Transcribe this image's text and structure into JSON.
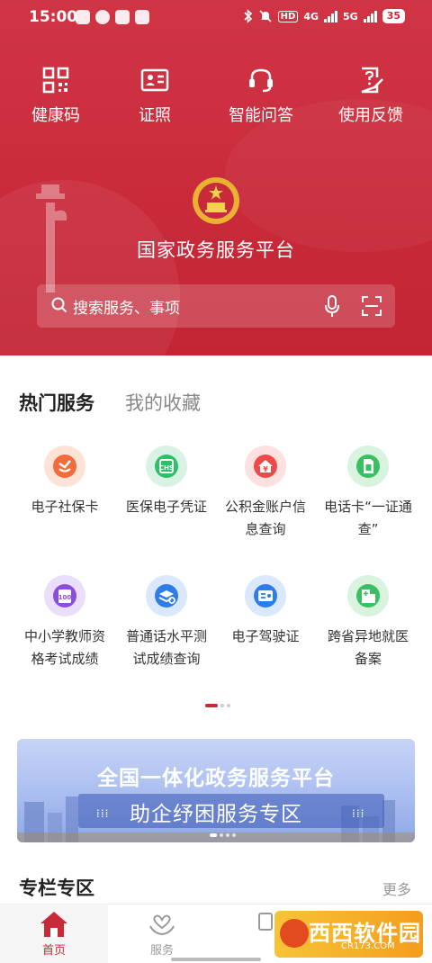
{
  "status_bar": {
    "time": "15:00",
    "hd": "HD",
    "net_4g": "4G",
    "net_5g": "5G",
    "battery": "35"
  },
  "quick_actions": [
    {
      "label": "健康码",
      "icon": "qr-code-icon"
    },
    {
      "label": "证照",
      "icon": "id-card-icon"
    },
    {
      "label": "智能问答",
      "icon": "headset-icon"
    },
    {
      "label": "使用反馈",
      "icon": "feedback-icon"
    }
  ],
  "header": {
    "platform_title": "国家政务服务平台"
  },
  "search": {
    "placeholder": "搜索服务、事项"
  },
  "tabs": [
    {
      "label": "热门服务",
      "active": true
    },
    {
      "label": "我的收藏",
      "active": false
    }
  ],
  "services": [
    {
      "label": "电子社保卡",
      "icon": "social-security-icon",
      "color": "#f26b3a"
    },
    {
      "label": "医保电子凭证",
      "icon": "medical-insurance-icon",
      "color": "#2fbf6a"
    },
    {
      "label": "公积金账户信息查询",
      "icon": "housing-fund-icon",
      "color": "#ee4a4a"
    },
    {
      "label": "电话卡“一证通查”",
      "icon": "sim-card-icon",
      "color": "#3cbf63"
    },
    {
      "label": "中小学教师资格考试成绩",
      "icon": "teacher-exam-icon",
      "color": "#8a4de0"
    },
    {
      "label": "普通话水平测试成绩查询",
      "icon": "mandarin-test-icon",
      "color": "#2d7de8"
    },
    {
      "label": "电子驾驶证",
      "icon": "driver-license-icon",
      "color": "#2d7de8"
    },
    {
      "label": "跨省异地就医备案",
      "icon": "hospital-icon",
      "color": "#3cbf63"
    }
  ],
  "banner": {
    "headline": "全国一体化政务服务平台",
    "subheadline": "助企纾困服务专区"
  },
  "section": {
    "title": "专栏专区",
    "more": "更多"
  },
  "bottom_nav": [
    {
      "label": "首页",
      "active": true
    },
    {
      "label": "服务",
      "active": false
    }
  ],
  "watermark": {
    "text": "西西软件园",
    "sub": "CR173.COM"
  },
  "colors": {
    "brand_red": "#c92a3a",
    "highlight_box": "#ff2a2a"
  }
}
